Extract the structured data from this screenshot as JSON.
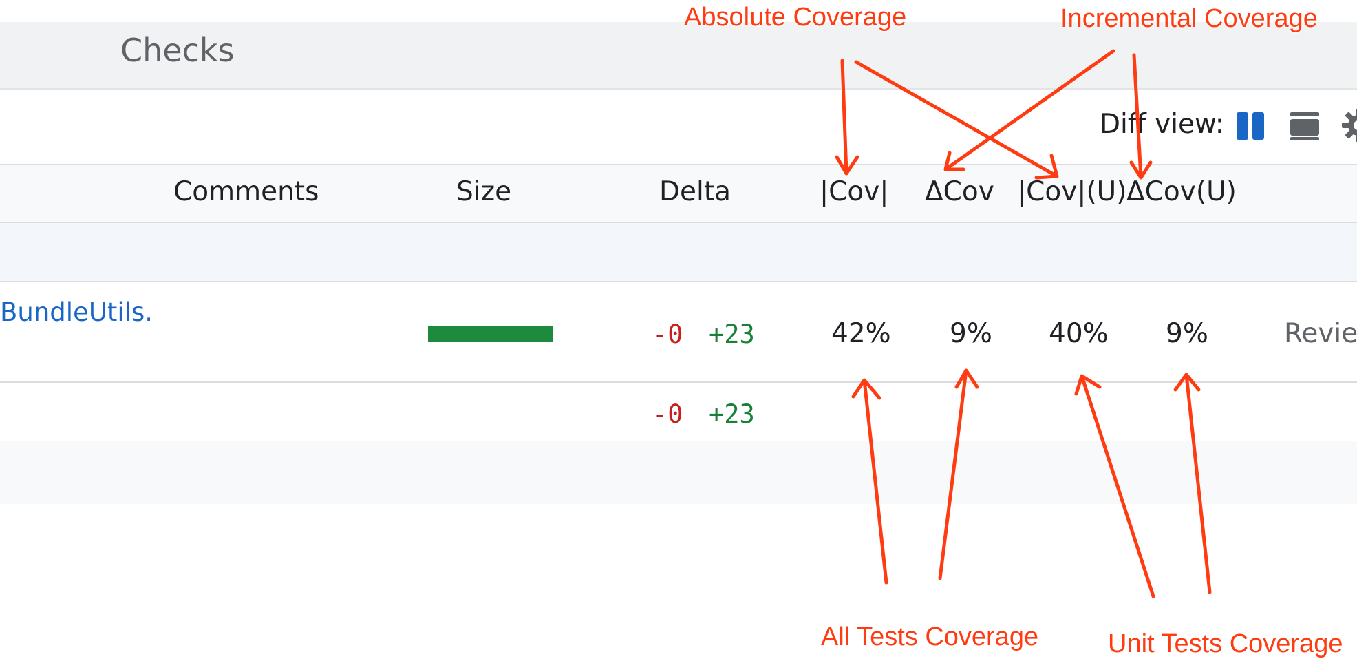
{
  "header": {
    "title": "Checks"
  },
  "diff_view": {
    "label": "Diff view:",
    "split_icon": "side-by-side-icon",
    "unified_icon": "unified-diff-icon",
    "settings_icon": "gear-icon"
  },
  "table": {
    "columns": [
      "Comments",
      "Size",
      "Delta",
      "|Cov|",
      "ΔCov",
      "|Cov|(U)",
      "ΔCov(U)"
    ],
    "rows": [
      {
        "file": "BundleUtils.",
        "size_fraction": 1.0,
        "delta_removed": "-0",
        "delta_added": "+23",
        "cov": "42%",
        "dcov": "9%",
        "cov_u": "40%",
        "dcov_u": "9%",
        "status": "Reviev"
      }
    ],
    "total": {
      "delta_removed": "-0",
      "delta_added": "+23"
    }
  },
  "annotations": {
    "absolute": "Absolute Coverage",
    "incremental": "Incremental Coverage",
    "all_tests": "All Tests Coverage",
    "unit_tests": "Unit Tests Coverage"
  },
  "colors": {
    "accent": "#1a66c4",
    "added": "#188038",
    "removed": "#c5221f",
    "annotation": "#ff3b12",
    "size_bar": "#1e8a3e"
  }
}
